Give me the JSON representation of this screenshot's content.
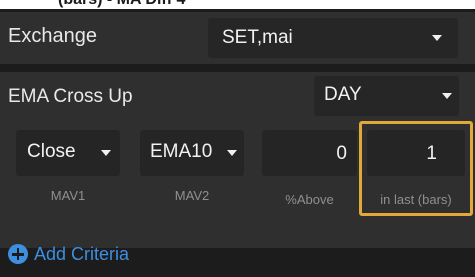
{
  "header": {
    "partial_text": "(bars) - MA Diff 4"
  },
  "exchange": {
    "label": "Exchange",
    "value": "SET,mai"
  },
  "ema": {
    "label": "EMA Cross Up",
    "timeframe": "DAY"
  },
  "params": {
    "mav1": {
      "value": "Close",
      "caption": "MAV1"
    },
    "mav2": {
      "value": "EMA10",
      "caption": "MAV2"
    },
    "above": {
      "value": "0",
      "caption": "%Above"
    },
    "in_last": {
      "value": "1",
      "caption": "in last (bars)"
    }
  },
  "actions": {
    "add_criteria": "Add Criteria"
  },
  "colors": {
    "accent": "#3d8fe0",
    "highlight": "#e0a93a",
    "background": "#1c1c1c",
    "panel": "#2f2f2f"
  }
}
